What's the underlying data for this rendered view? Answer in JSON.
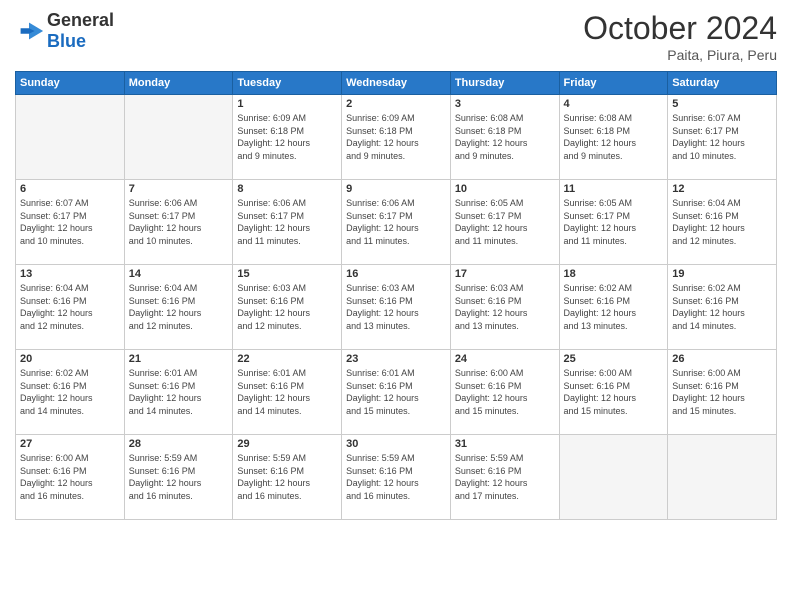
{
  "header": {
    "logo_general": "General",
    "logo_blue": "Blue",
    "month": "October 2024",
    "location": "Paita, Piura, Peru"
  },
  "weekdays": [
    "Sunday",
    "Monday",
    "Tuesday",
    "Wednesday",
    "Thursday",
    "Friday",
    "Saturday"
  ],
  "weeks": [
    [
      {
        "day": "",
        "info": ""
      },
      {
        "day": "",
        "info": ""
      },
      {
        "day": "1",
        "info": "Sunrise: 6:09 AM\nSunset: 6:18 PM\nDaylight: 12 hours\nand 9 minutes."
      },
      {
        "day": "2",
        "info": "Sunrise: 6:09 AM\nSunset: 6:18 PM\nDaylight: 12 hours\nand 9 minutes."
      },
      {
        "day": "3",
        "info": "Sunrise: 6:08 AM\nSunset: 6:18 PM\nDaylight: 12 hours\nand 9 minutes."
      },
      {
        "day": "4",
        "info": "Sunrise: 6:08 AM\nSunset: 6:18 PM\nDaylight: 12 hours\nand 9 minutes."
      },
      {
        "day": "5",
        "info": "Sunrise: 6:07 AM\nSunset: 6:17 PM\nDaylight: 12 hours\nand 10 minutes."
      }
    ],
    [
      {
        "day": "6",
        "info": "Sunrise: 6:07 AM\nSunset: 6:17 PM\nDaylight: 12 hours\nand 10 minutes."
      },
      {
        "day": "7",
        "info": "Sunrise: 6:06 AM\nSunset: 6:17 PM\nDaylight: 12 hours\nand 10 minutes."
      },
      {
        "day": "8",
        "info": "Sunrise: 6:06 AM\nSunset: 6:17 PM\nDaylight: 12 hours\nand 11 minutes."
      },
      {
        "day": "9",
        "info": "Sunrise: 6:06 AM\nSunset: 6:17 PM\nDaylight: 12 hours\nand 11 minutes."
      },
      {
        "day": "10",
        "info": "Sunrise: 6:05 AM\nSunset: 6:17 PM\nDaylight: 12 hours\nand 11 minutes."
      },
      {
        "day": "11",
        "info": "Sunrise: 6:05 AM\nSunset: 6:17 PM\nDaylight: 12 hours\nand 11 minutes."
      },
      {
        "day": "12",
        "info": "Sunrise: 6:04 AM\nSunset: 6:16 PM\nDaylight: 12 hours\nand 12 minutes."
      }
    ],
    [
      {
        "day": "13",
        "info": "Sunrise: 6:04 AM\nSunset: 6:16 PM\nDaylight: 12 hours\nand 12 minutes."
      },
      {
        "day": "14",
        "info": "Sunrise: 6:04 AM\nSunset: 6:16 PM\nDaylight: 12 hours\nand 12 minutes."
      },
      {
        "day": "15",
        "info": "Sunrise: 6:03 AM\nSunset: 6:16 PM\nDaylight: 12 hours\nand 12 minutes."
      },
      {
        "day": "16",
        "info": "Sunrise: 6:03 AM\nSunset: 6:16 PM\nDaylight: 12 hours\nand 13 minutes."
      },
      {
        "day": "17",
        "info": "Sunrise: 6:03 AM\nSunset: 6:16 PM\nDaylight: 12 hours\nand 13 minutes."
      },
      {
        "day": "18",
        "info": "Sunrise: 6:02 AM\nSunset: 6:16 PM\nDaylight: 12 hours\nand 13 minutes."
      },
      {
        "day": "19",
        "info": "Sunrise: 6:02 AM\nSunset: 6:16 PM\nDaylight: 12 hours\nand 14 minutes."
      }
    ],
    [
      {
        "day": "20",
        "info": "Sunrise: 6:02 AM\nSunset: 6:16 PM\nDaylight: 12 hours\nand 14 minutes."
      },
      {
        "day": "21",
        "info": "Sunrise: 6:01 AM\nSunset: 6:16 PM\nDaylight: 12 hours\nand 14 minutes."
      },
      {
        "day": "22",
        "info": "Sunrise: 6:01 AM\nSunset: 6:16 PM\nDaylight: 12 hours\nand 14 minutes."
      },
      {
        "day": "23",
        "info": "Sunrise: 6:01 AM\nSunset: 6:16 PM\nDaylight: 12 hours\nand 15 minutes."
      },
      {
        "day": "24",
        "info": "Sunrise: 6:00 AM\nSunset: 6:16 PM\nDaylight: 12 hours\nand 15 minutes."
      },
      {
        "day": "25",
        "info": "Sunrise: 6:00 AM\nSunset: 6:16 PM\nDaylight: 12 hours\nand 15 minutes."
      },
      {
        "day": "26",
        "info": "Sunrise: 6:00 AM\nSunset: 6:16 PM\nDaylight: 12 hours\nand 15 minutes."
      }
    ],
    [
      {
        "day": "27",
        "info": "Sunrise: 6:00 AM\nSunset: 6:16 PM\nDaylight: 12 hours\nand 16 minutes."
      },
      {
        "day": "28",
        "info": "Sunrise: 5:59 AM\nSunset: 6:16 PM\nDaylight: 12 hours\nand 16 minutes."
      },
      {
        "day": "29",
        "info": "Sunrise: 5:59 AM\nSunset: 6:16 PM\nDaylight: 12 hours\nand 16 minutes."
      },
      {
        "day": "30",
        "info": "Sunrise: 5:59 AM\nSunset: 6:16 PM\nDaylight: 12 hours\nand 16 minutes."
      },
      {
        "day": "31",
        "info": "Sunrise: 5:59 AM\nSunset: 6:16 PM\nDaylight: 12 hours\nand 17 minutes."
      },
      {
        "day": "",
        "info": ""
      },
      {
        "day": "",
        "info": ""
      }
    ]
  ]
}
